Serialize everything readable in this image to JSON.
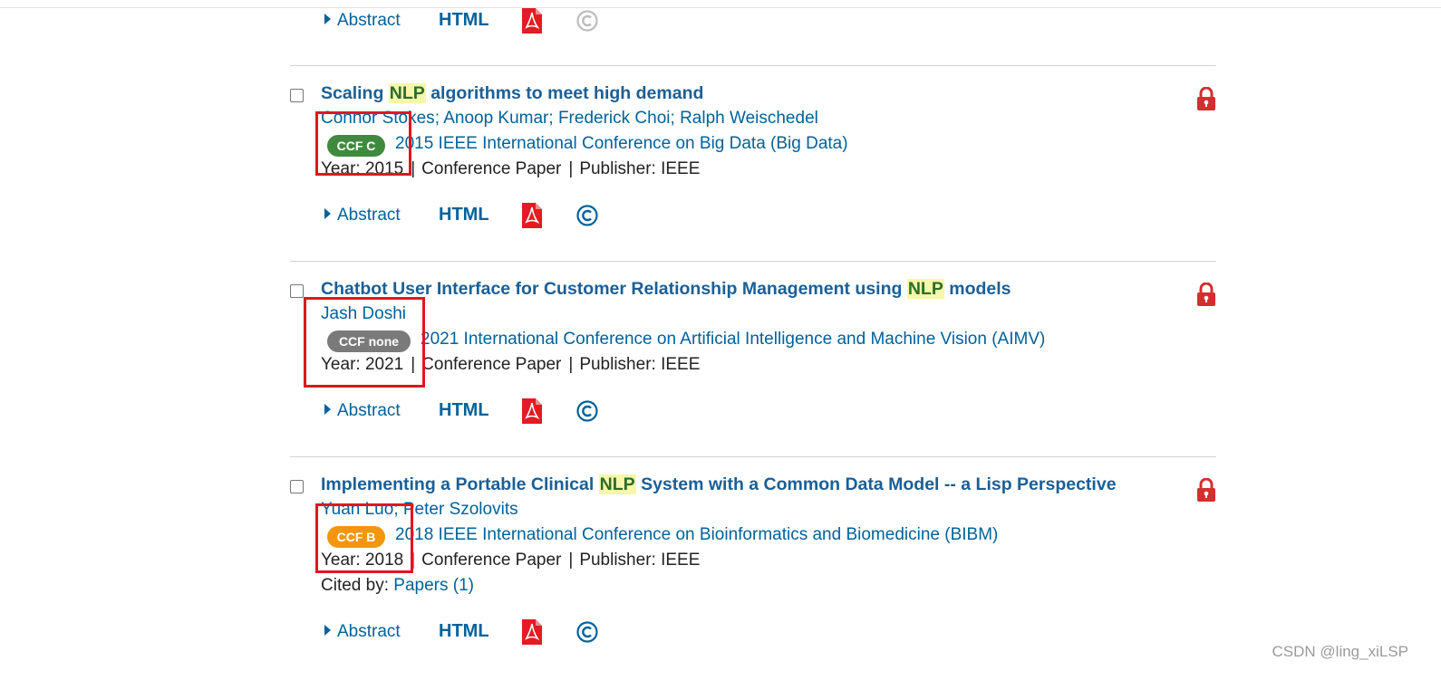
{
  "actions": {
    "abstract_label": "Abstract",
    "html_label": "HTML"
  },
  "colors": {
    "link": "#00629b",
    "title": "#1a5f96",
    "highlight_bg": "#f6f7a9",
    "lock": "#d32f2f",
    "pdf": "#e31b23",
    "annotation_box": "#e0161f",
    "ccf_c": "#3f8a3f",
    "ccf_none": "#7a7a7a",
    "ccf_b": "#f2960f"
  },
  "results": [
    {
      "title_before": "Scaling ",
      "title_highlight": "NLP",
      "title_after": " algorithms to meet high demand",
      "authors": [
        "Connor Stokes",
        "Anoop Kumar",
        "Frederick Choi",
        "Ralph Weischedel"
      ],
      "ccf_badge": "CCF C",
      "ccf_color": "#3f8a3f",
      "venue": "2015 IEEE International Conference on Big Data (Big Data)",
      "year_text": "Year: 2015",
      "doc_type": "Conference Paper",
      "publisher_text": "Publisher:  IEEE"
    },
    {
      "title_before": "Chatbot User Interface for Customer Relationship Management using ",
      "title_highlight": "NLP",
      "title_after": " models",
      "authors": [
        "Jash Doshi"
      ],
      "ccf_badge": "CCF none",
      "ccf_color": "#7a7a7a",
      "venue": "2021 International Conference on Artificial Intelligence and Machine Vision (AIMV)",
      "year_text": "Year: 2021",
      "doc_type": "Conference Paper",
      "publisher_text": "Publisher:  IEEE"
    },
    {
      "title_before": "Implementing a Portable Clinical ",
      "title_highlight": "NLP",
      "title_after": " System with a Common Data Model -- a Lisp Perspective",
      "authors": [
        "Yuan Luo",
        "Peter Szolovits"
      ],
      "ccf_badge": "CCF B",
      "ccf_color": "#f2960f",
      "venue": "2018 IEEE International Conference on Bioinformatics and Biomedicine (BIBM)",
      "year_text": "Year: 2018",
      "doc_type": "Conference Paper",
      "publisher_text": "Publisher:  IEEE",
      "cited_label": "Cited by: ",
      "cited_link": "Papers (1)"
    }
  ],
  "separator": "|",
  "author_separator": "; ",
  "watermark": "CSDN @ling_xiLSP"
}
